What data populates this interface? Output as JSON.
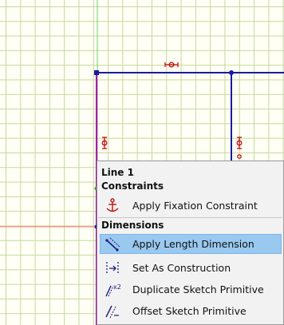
{
  "context_menu": {
    "title": "Line 1",
    "constraints_header": "Constraints",
    "dimensions_header": "Dimensions",
    "items": [
      {
        "label": "Apply Fixation Constraint",
        "icon": "anchor-icon"
      },
      {
        "label": "Apply Length Dimension",
        "icon": "length-dimension-icon",
        "highlighted": true
      },
      {
        "label": "Set As Construction",
        "icon": "construction-icon"
      },
      {
        "label": "Duplicate Sketch Primitive",
        "icon": "duplicate-icon"
      },
      {
        "label": "Offset Sketch Primitive",
        "icon": "offset-icon"
      }
    ]
  },
  "colors": {
    "grid": "#c6d79a",
    "grid_background": "#fffff6",
    "sketch_line": "#1a1aa0",
    "selected_line": "#b000b0",
    "axis_green": "#6ccf6c",
    "axis_red": "#ff7070",
    "constraint_marker": "#c01010",
    "highlight": "#99c9ef"
  }
}
